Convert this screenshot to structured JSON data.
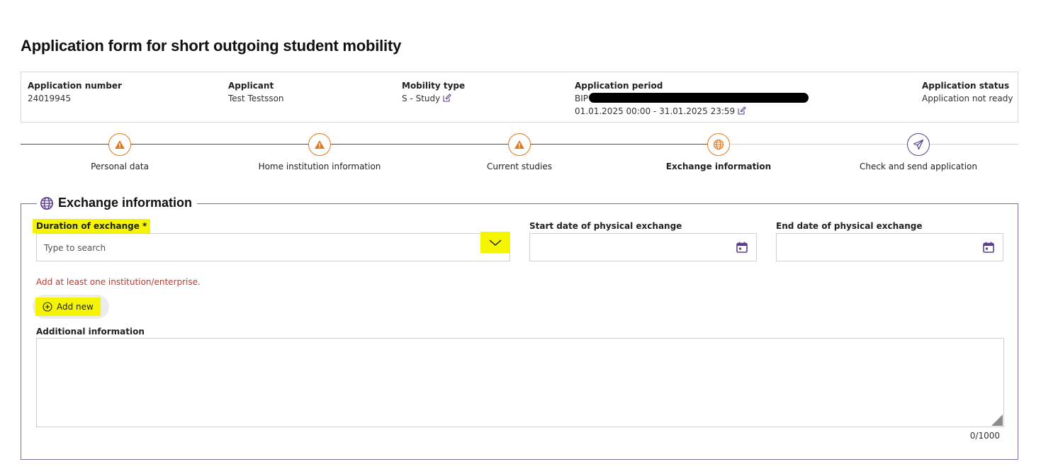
{
  "page": {
    "title": "Application form for short outgoing student mobility"
  },
  "summary": {
    "application_number": {
      "label": "Application number",
      "value": "24019945"
    },
    "applicant": {
      "label": "Applicant",
      "value": "Test Testsson"
    },
    "mobility_type": {
      "label": "Mobility type",
      "value": "S - Study"
    },
    "application_period": {
      "label": "Application period",
      "prefix": "BIP",
      "dates": "01.01.2025 00:00 - 31.01.2025 23:59"
    },
    "application_status": {
      "label": "Application status",
      "value": "Application not ready"
    }
  },
  "steps": [
    {
      "label": "Personal data",
      "icon": "warning-icon"
    },
    {
      "label": "Home institution information",
      "icon": "warning-icon"
    },
    {
      "label": "Current studies",
      "icon": "warning-icon"
    },
    {
      "label": "Exchange information",
      "icon": "globe-icon",
      "active": true
    },
    {
      "label": "Check and send application",
      "icon": "send-icon"
    }
  ],
  "exchange": {
    "legend": "Exchange information",
    "duration": {
      "label": "Duration of exchange *",
      "placeholder": "Type to search"
    },
    "start_date": {
      "label": "Start date of physical exchange"
    },
    "end_date": {
      "label": "End date of physical exchange"
    },
    "error": "Add at least one institution/enterprise.",
    "add_new": "Add new",
    "additional": {
      "label": "Additional information",
      "counter": "0/1000"
    }
  },
  "colors": {
    "accent": "#5b3f8f",
    "warning": "#e07a1f",
    "highlight": "#f5f500",
    "error": "#c0392b"
  }
}
